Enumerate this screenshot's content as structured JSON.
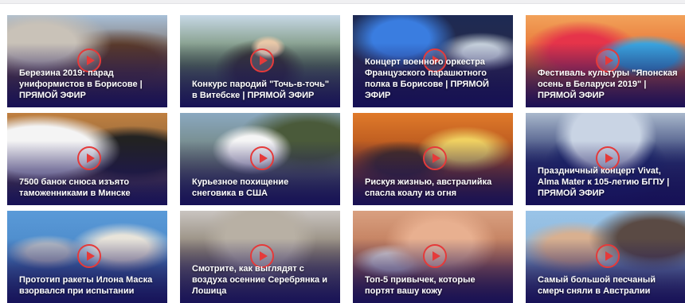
{
  "colors": {
    "accent": "#e53a3a",
    "overlay": "#1c145c",
    "title_text": "#ffffff"
  },
  "cards": [
    {
      "title": "Березина 2019: парад униформистов в Борисове | ПРЯМОЙ ЭФИР",
      "icon": "play-icon"
    },
    {
      "title": "Конкурс пародий \"Точь-в-точь\" в Витебске | ПРЯМОЙ ЭФИР",
      "icon": "play-icon"
    },
    {
      "title": "Концерт военного оркестра Французского парашютного полка в Борисове | ПРЯМОЙ ЭФИР",
      "icon": "play-icon"
    },
    {
      "title": "Фестиваль культуры \"Японская осень в Беларуси 2019\" | ПРЯМОЙ ЭФИР",
      "icon": "play-icon"
    },
    {
      "title": "7500 банок снюса изъято таможенниками в Минске",
      "icon": "play-icon"
    },
    {
      "title": "Курьезное похищение снеговика в США",
      "icon": "play-icon"
    },
    {
      "title": "Рискуя жизнью, австралийка спасла коалу из огня",
      "icon": "play-icon"
    },
    {
      "title": "Праздничный концерт Vivat, Alma Mater к 105-летию БГПУ | ПРЯМОЙ ЭФИР",
      "icon": "play-icon"
    },
    {
      "title": "Прототип ракеты Илона Маска взорвался при испытании",
      "icon": "play-icon"
    },
    {
      "title": "Смотрите, как выглядят с воздуха осенние Серебрянка и Лошица",
      "icon": "play-icon"
    },
    {
      "title": "Топ-5 привычек, которые портят вашу кожу",
      "icon": "play-icon"
    },
    {
      "title": "Самый большой песчаный смерч сняли в Австралии",
      "icon": "play-icon"
    }
  ]
}
